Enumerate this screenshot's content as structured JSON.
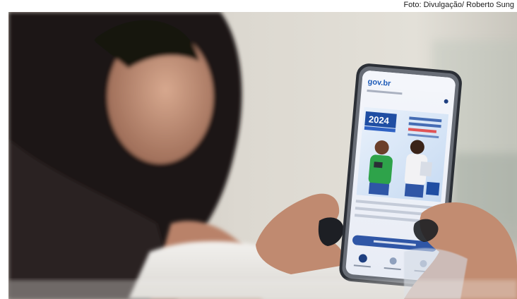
{
  "credit": "Foto: Divulgação/ Roberto Sung",
  "photo": {
    "alt_subject": "person-holding-smartphone",
    "screen": {
      "app_logo": "gov.br",
      "banner_year": "2024"
    },
    "colors": {
      "background_wall": "#d8d5cd",
      "hair": "#141210",
      "skin": "#c48f74",
      "phone_frame": "#2b2f36",
      "screen_blue": "#2f56a6",
      "nail_polish": "#1d1f24"
    }
  }
}
